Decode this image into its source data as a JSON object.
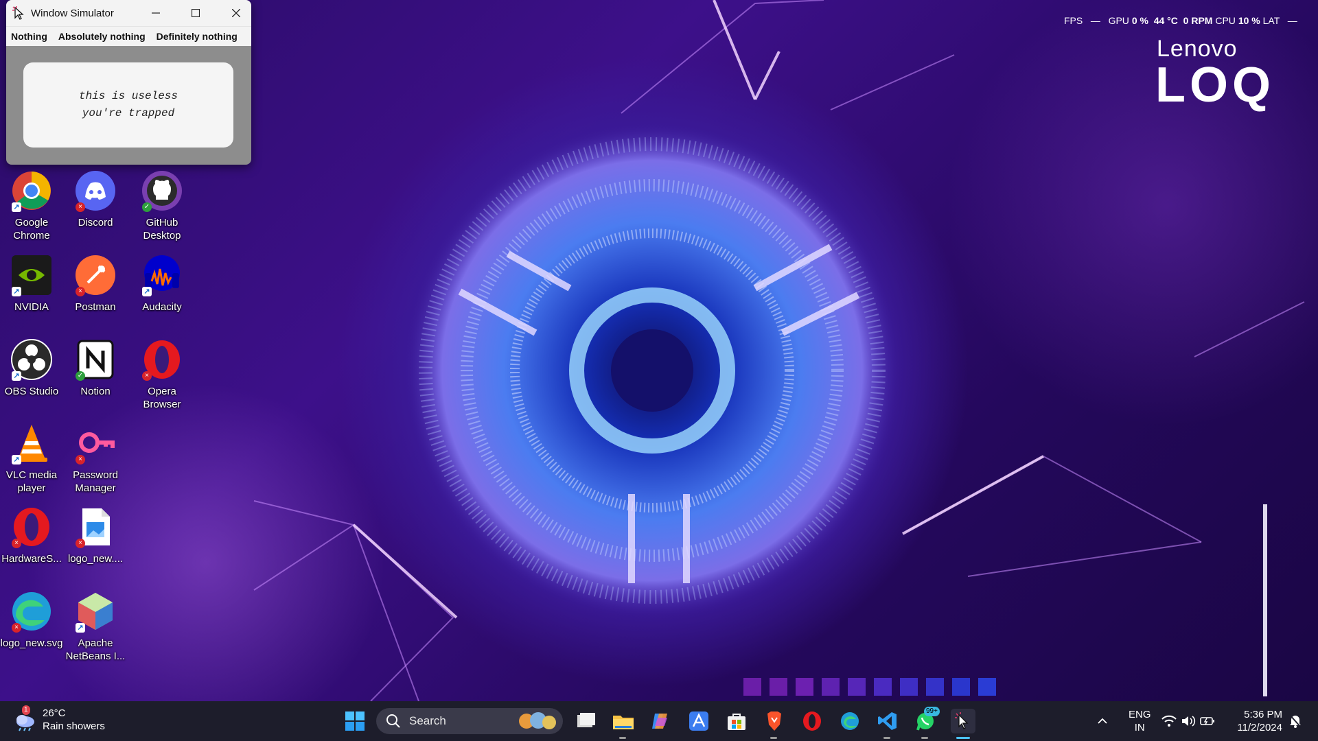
{
  "window": {
    "title": "Window Simulator",
    "menu": [
      "Nothing",
      "Absolutely nothing",
      "Definitely nothing"
    ],
    "body_lines": [
      "this is useless",
      "you're trapped"
    ]
  },
  "desktop_icons": [
    {
      "label": "Google\nChrome",
      "icon": "chrome-icon",
      "overlay": "shortcut"
    },
    {
      "label": "Discord",
      "icon": "discord-icon",
      "overlay": "error"
    },
    {
      "label": "GitHub\nDesktop",
      "icon": "github-icon",
      "overlay": "synced"
    },
    {
      "label": "NVIDIA",
      "icon": "nvidia-icon",
      "overlay": "shortcut"
    },
    {
      "label": "Postman",
      "icon": "postman-icon",
      "overlay": "error"
    },
    {
      "label": "Audacity",
      "icon": "audacity-icon",
      "overlay": "shortcut"
    },
    {
      "label": "OBS Studio",
      "icon": "obs-icon",
      "overlay": "shortcut"
    },
    {
      "label": "Notion",
      "icon": "notion-icon",
      "overlay": "synced"
    },
    {
      "label": "Opera\nBrowser",
      "icon": "opera-icon",
      "overlay": "error"
    },
    {
      "label": "VLC media\nplayer",
      "icon": "vlc-icon",
      "overlay": "shortcut"
    },
    {
      "label": "Password\nManager",
      "icon": "key-icon",
      "overlay": "error"
    },
    {
      "label": "HardwareS...",
      "icon": "opera-icon",
      "overlay": "error"
    },
    {
      "label": "logo_new....",
      "icon": "image-file-icon",
      "overlay": "error"
    },
    {
      "label": "logo_new.svg",
      "icon": "edge-icon",
      "overlay": "error"
    },
    {
      "label": "Apache\nNetBeans I...",
      "icon": "netbeans-icon",
      "overlay": "shortcut"
    }
  ],
  "overlay": {
    "fps_label": "FPS",
    "fps_value": "—",
    "gpu_label": "GPU",
    "gpu_usage": "0 %",
    "gpu_temp": "44 °C",
    "gpu_fan": "0 RPM",
    "cpu_label": "CPU",
    "cpu_usage": "10 %",
    "lat_label": "LAT",
    "lat_value": "—"
  },
  "brand": {
    "line1": "Lenovo",
    "line2": "LOQ"
  },
  "colors": {
    "squares": [
      "#6a1ea8",
      "#6a1ea8",
      "#6c20b0",
      "#5e22b0",
      "#5626b8",
      "#4a2ac0",
      "#3e2ec4",
      "#3432c8",
      "#2a36cc",
      "#2a3cd4"
    ],
    "taskbar": "#1d1d2b",
    "accent": "#39b9e0"
  },
  "taskbar": {
    "weather": {
      "alert_count": "1",
      "temp": "26°C",
      "desc": "Rain showers"
    },
    "search_label": "Search",
    "apps": [
      "start-icon",
      "task-view-icon",
      "file-explorer-icon",
      "copilot-icon",
      "app-icon",
      "store-icon",
      "brave-icon",
      "opera-icon",
      "edge-icon",
      "vscode-icon",
      "whatsapp-icon",
      "window-simulator-icon"
    ],
    "whatsapp_badge": "99+",
    "language": {
      "line1": "ENG",
      "line2": "IN"
    },
    "time": "5:36 PM",
    "date": "11/2/2024"
  }
}
